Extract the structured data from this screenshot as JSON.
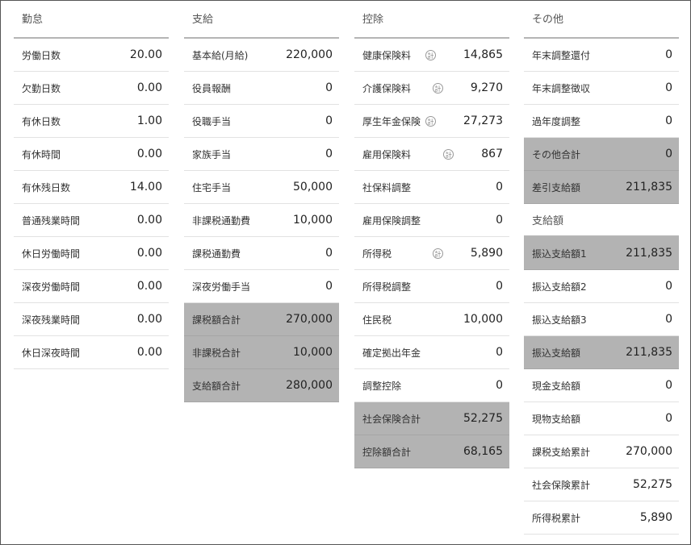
{
  "kintai": {
    "title": "勤怠",
    "rows": [
      {
        "label": "労働日数",
        "value": "20.00"
      },
      {
        "label": "欠勤日数",
        "value": "0.00"
      },
      {
        "label": "有休日数",
        "value": "1.00"
      },
      {
        "label": "有休時間",
        "value": "0.00"
      },
      {
        "label": "有休残日数",
        "value": "14.00"
      },
      {
        "label": "普通残業時間",
        "value": "0.00"
      },
      {
        "label": "休日労働時間",
        "value": "0.00"
      },
      {
        "label": "深夜労働時間",
        "value": "0.00"
      },
      {
        "label": "深夜残業時間",
        "value": "0.00"
      },
      {
        "label": "休日深夜時間",
        "value": "0.00"
      }
    ]
  },
  "shikyu": {
    "title": "支給",
    "rows": [
      {
        "label": "基本給(月給)",
        "value": "220,000"
      },
      {
        "label": "役員報酬",
        "value": "0"
      },
      {
        "label": "役職手当",
        "value": "0"
      },
      {
        "label": "家族手当",
        "value": "0"
      },
      {
        "label": "住宅手当",
        "value": "50,000"
      },
      {
        "label": "非課税通勤費",
        "value": "10,000"
      },
      {
        "label": "課税通勤費",
        "value": "0"
      },
      {
        "label": "深夜労働手当",
        "value": "0"
      },
      {
        "label": "課税額合計",
        "value": "270,000"
      },
      {
        "label": "非課税合計",
        "value": "10,000"
      },
      {
        "label": "支給額合計",
        "value": "280,000"
      }
    ]
  },
  "kojo": {
    "title": "控除",
    "calc_glyph": "計",
    "rows": [
      {
        "label": "健康保険料",
        "value": "14,865"
      },
      {
        "label": "介護保険料",
        "value": "9,270"
      },
      {
        "label": "厚生年金保険",
        "value": "27,273"
      },
      {
        "label": "雇用保険料",
        "value": "867"
      },
      {
        "label": "社保料調整",
        "value": "0"
      },
      {
        "label": "雇用保険調整",
        "value": "0"
      },
      {
        "label": "所得税",
        "value": "5,890"
      },
      {
        "label": "所得税調整",
        "value": "0"
      },
      {
        "label": "住民税",
        "value": "10,000"
      },
      {
        "label": "確定拠出年金",
        "value": "0"
      },
      {
        "label": "調整控除",
        "value": "0"
      },
      {
        "label": "社会保険合計",
        "value": "52,275"
      },
      {
        "label": "控除額合計",
        "value": "68,165"
      }
    ]
  },
  "sonota": {
    "title": "その他",
    "rows": [
      {
        "label": "年末調整還付",
        "value": "0"
      },
      {
        "label": "年末調整徴収",
        "value": "0"
      },
      {
        "label": "過年度調整",
        "value": "0"
      },
      {
        "label": "その他合計",
        "value": "0"
      },
      {
        "label": "差引支給額",
        "value": "211,835"
      }
    ],
    "subtitle": "支給額",
    "rows2": [
      {
        "label": "振込支給額1",
        "value": "211,835"
      },
      {
        "label": "振込支給額2",
        "value": "0"
      },
      {
        "label": "振込支給額3",
        "value": "0"
      },
      {
        "label": "振込支給額",
        "value": "211,835"
      },
      {
        "label": "現金支給額",
        "value": "0"
      },
      {
        "label": "現物支給額",
        "value": "0"
      },
      {
        "label": "課税支給累計",
        "value": "270,000"
      },
      {
        "label": "社会保険累計",
        "value": "52,275"
      },
      {
        "label": "所得税累計",
        "value": "5,890"
      }
    ]
  }
}
